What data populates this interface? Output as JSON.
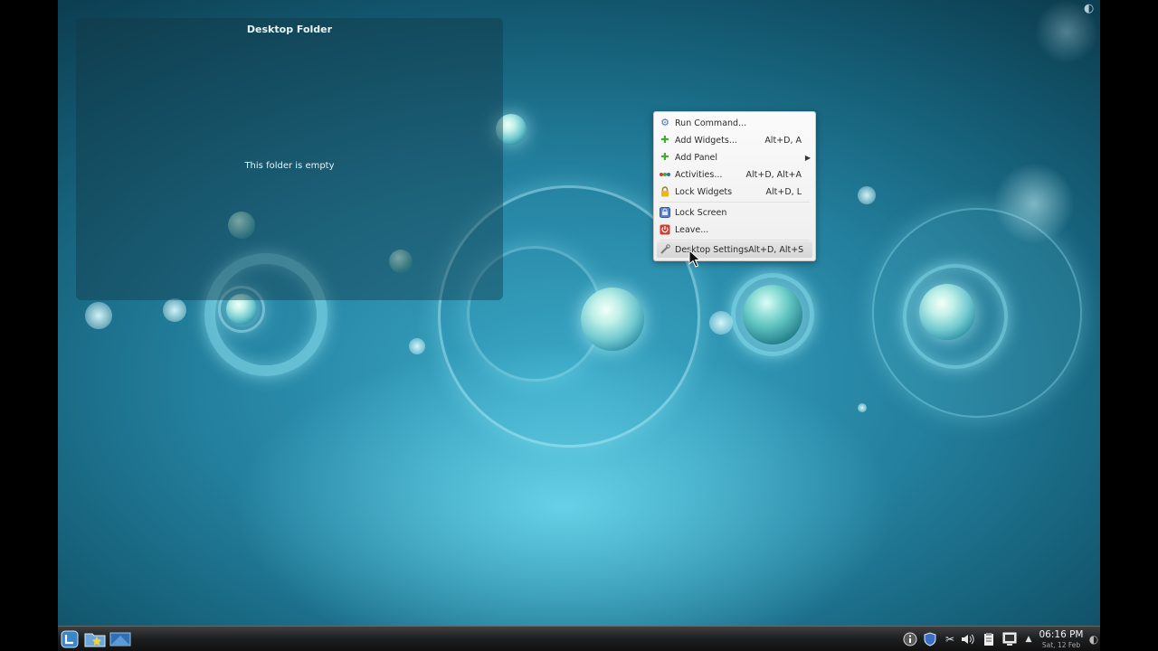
{
  "desktop_folder": {
    "title": "Desktop Folder",
    "empty_message": "This folder is empty"
  },
  "context_menu": {
    "items": [
      {
        "label": "Run Command...",
        "shortcut": "",
        "icon": "run-icon"
      },
      {
        "label": "Add Widgets...",
        "shortcut": "Alt+D, A",
        "icon": "plus-icon"
      },
      {
        "label": "Add Panel",
        "shortcut": "",
        "icon": "plus-icon",
        "submenu": true
      },
      {
        "label": "Activities...",
        "shortcut": "Alt+D, Alt+A",
        "icon": "activities-icon"
      },
      {
        "label": "Lock Widgets",
        "shortcut": "Alt+D, L",
        "icon": "lock-icon"
      },
      {
        "label": "Lock Screen",
        "shortcut": "",
        "icon": "lock-screen-icon"
      },
      {
        "label": "Leave...",
        "shortcut": "",
        "icon": "leave-icon"
      },
      {
        "label": "Desktop Settings",
        "shortcut": "Alt+D, Alt+S",
        "icon": "settings-icon",
        "highlighted": true
      }
    ]
  },
  "taskbar": {
    "launchers": [
      "kickoff-menu-icon",
      "folder-view-icon",
      "show-desktop-icon"
    ],
    "tray": [
      "info-icon",
      "security-shield-icon",
      "klipper-scissors-icon",
      "volume-icon",
      "clipboard-icon",
      "network-icon",
      "expand-tray-icon"
    ],
    "clock": {
      "time": "06:16 PM",
      "date": "Sat, 12 Feb"
    }
  },
  "colors": {
    "wallpaper": "#23809e",
    "menu_bg": "#f5f5f5",
    "taskbar": "#1d1e1f",
    "accent_green": "#3fae2c",
    "accent_red": "#d23b2f"
  }
}
